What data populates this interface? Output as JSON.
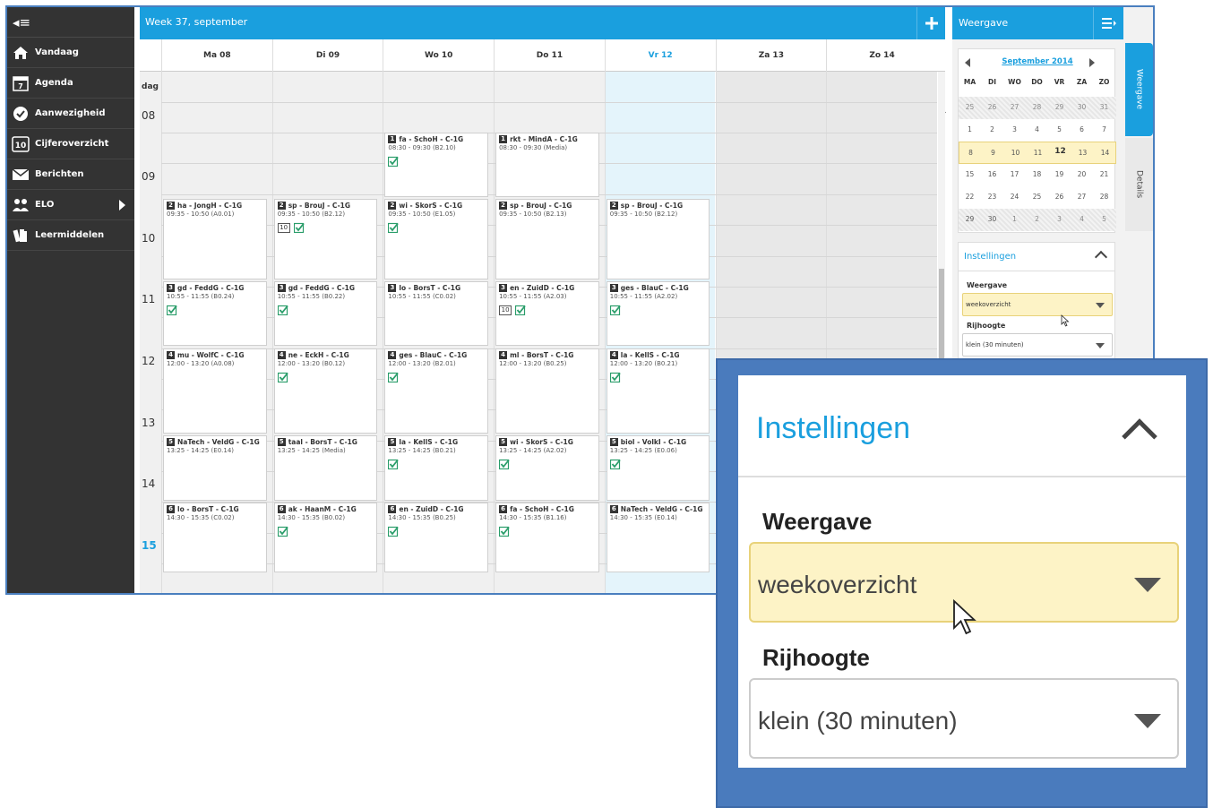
{
  "sidebar": {
    "collapse_icon": "collapse-menu-icon",
    "items": [
      {
        "label": "Vandaag",
        "icon": "home-icon"
      },
      {
        "label": "Agenda",
        "icon": "calendar-icon",
        "badge": "7"
      },
      {
        "label": "Aanwezigheid",
        "icon": "check-circle-icon"
      },
      {
        "label": "Cijferoverzicht",
        "icon": "grades-icon",
        "badge": "10"
      },
      {
        "label": "Berichten",
        "icon": "envelope-icon"
      },
      {
        "label": "ELO",
        "icon": "people-icon"
      },
      {
        "label": "Leermiddelen",
        "icon": "books-icon"
      }
    ]
  },
  "calendar": {
    "title": "Week 37, september",
    "add_icon": "plus-icon",
    "days": [
      "Ma 08",
      "Di 09",
      "Wo 10",
      "Do 11",
      "Vr 12",
      "Za 13",
      "Zo 14"
    ],
    "today_index": 4,
    "time_labels": [
      "dag",
      "08",
      "09",
      "10",
      "11",
      "12",
      "13",
      "14",
      "15"
    ],
    "events": [
      {
        "day": 2,
        "row": 0,
        "num": "1",
        "title": "fa - SchoH - C-1G",
        "time": "08:30 - 09:30 (B2.10)",
        "check": true,
        "ten": false
      },
      {
        "day": 3,
        "row": 0,
        "num": "1",
        "title": "rkt - MindA - C-1G",
        "time": "08:30 - 09:30 (Media)",
        "check": false,
        "ten": false
      },
      {
        "day": 0,
        "row": 1,
        "num": "2",
        "title": "ha - JongH - C-1G",
        "time": "09:35 - 10:50 (A0.01)",
        "check": false,
        "ten": false
      },
      {
        "day": 1,
        "row": 1,
        "num": "2",
        "title": "sp - BrouJ - C-1G",
        "time": "09:35 - 10:50 (B2.12)",
        "check": true,
        "ten": true
      },
      {
        "day": 2,
        "row": 1,
        "num": "2",
        "title": "wi - SkorS - C-1G",
        "time": "09:35 - 10:50 (E1.05)",
        "check": true,
        "ten": false
      },
      {
        "day": 3,
        "row": 1,
        "num": "2",
        "title": "sp - BrouJ - C-1G",
        "time": "09:35 - 10:50 (B2.13)",
        "check": false,
        "ten": false
      },
      {
        "day": 4,
        "row": 1,
        "num": "2",
        "title": "sp - BrouJ - C-1G",
        "time": "09:35 - 10:50 (B2.12)",
        "check": false,
        "ten": false
      },
      {
        "day": 0,
        "row": 2,
        "num": "3",
        "title": "gd - FeddG - C-1G",
        "time": "10:55 - 11:55 (B0.24)",
        "check": true,
        "ten": false
      },
      {
        "day": 1,
        "row": 2,
        "num": "3",
        "title": "gd - FeddG - C-1G",
        "time": "10:55 - 11:55 (B0.22)",
        "check": true,
        "ten": false
      },
      {
        "day": 2,
        "row": 2,
        "num": "3",
        "title": "lo - BorsT - C-1G",
        "time": "10:55 - 11:55 (C0.02)",
        "check": false,
        "ten": false
      },
      {
        "day": 3,
        "row": 2,
        "num": "3",
        "title": "en - ZuidD - C-1G",
        "time": "10:55 - 11:55 (A2.03)",
        "check": true,
        "ten": true
      },
      {
        "day": 4,
        "row": 2,
        "num": "3",
        "title": "ges - BlauC - C-1G",
        "time": "10:55 - 11:55 (A2.02)",
        "check": true,
        "ten": false
      },
      {
        "day": 0,
        "row": 3,
        "num": "4",
        "title": "mu - WolfC - C-1G",
        "time": "12:00 - 13:20 (A0.08)",
        "check": false,
        "ten": false
      },
      {
        "day": 1,
        "row": 3,
        "num": "4",
        "title": "ne - EckH - C-1G",
        "time": "12:00 - 13:20 (B0.12)",
        "check": true,
        "ten": false
      },
      {
        "day": 2,
        "row": 3,
        "num": "4",
        "title": "ges - BlauC - C-1G",
        "time": "12:00 - 13:20 (B2.01)",
        "check": true,
        "ten": false
      },
      {
        "day": 3,
        "row": 3,
        "num": "4",
        "title": "ml - BorsT - C-1G",
        "time": "12:00 - 13:20 (B0.25)",
        "check": false,
        "ten": false
      },
      {
        "day": 4,
        "row": 3,
        "num": "4",
        "title": "la - KellS - C-1G",
        "time": "12:00 - 13:20 (B0.21)",
        "check": true,
        "ten": false
      },
      {
        "day": 0,
        "row": 4,
        "num": "5",
        "title": "NaTech - VeldG - C-1G",
        "time": "13:25 - 14:25 (E0.14)",
        "check": false,
        "ten": false
      },
      {
        "day": 1,
        "row": 4,
        "num": "5",
        "title": "taal - BorsT - C-1G",
        "time": "13:25 - 14:25 (Media)",
        "check": false,
        "ten": false
      },
      {
        "day": 2,
        "row": 4,
        "num": "5",
        "title": "la - KellS - C-1G",
        "time": "13:25 - 14:25 (B0.21)",
        "check": true,
        "ten": false
      },
      {
        "day": 3,
        "row": 4,
        "num": "5",
        "title": "wi - SkorS - C-1G",
        "time": "13:25 - 14:25 (A2.02)",
        "check": true,
        "ten": false
      },
      {
        "day": 4,
        "row": 4,
        "num": "5",
        "title": "biol - VolkI - C-1G",
        "time": "13:25 - 14:25 (E0.06)",
        "check": true,
        "ten": false
      },
      {
        "day": 0,
        "row": 5,
        "num": "6",
        "title": "lo - BorsT - C-1G",
        "time": "14:30 - 15:35 (C0.02)",
        "check": false,
        "ten": false
      },
      {
        "day": 1,
        "row": 5,
        "num": "6",
        "title": "ak - HaanM - C-1G",
        "time": "14:30 - 15:35 (B0.02)",
        "check": true,
        "ten": false
      },
      {
        "day": 2,
        "row": 5,
        "num": "6",
        "title": "en - ZuidD - C-1G",
        "time": "14:30 - 15:35 (B0.25)",
        "check": true,
        "ten": false
      },
      {
        "day": 3,
        "row": 5,
        "num": "6",
        "title": "fa - SchoH - C-1G",
        "time": "14:30 - 15:35 (B1.16)",
        "check": true,
        "ten": false
      },
      {
        "day": 4,
        "row": 5,
        "num": "6",
        "title": "NaTech - VeldG - C-1G",
        "time": "14:30 - 15:35 (E0.14)",
        "check": false,
        "ten": false
      }
    ],
    "ten_label": "10"
  },
  "panel": {
    "title": "Weergave",
    "tabs": [
      "Weergave",
      "Details"
    ],
    "minical": {
      "title": "September 2014",
      "weekdays": [
        "MA",
        "DI",
        "WO",
        "DO",
        "VR",
        "ZA",
        "ZO"
      ],
      "weeks": [
        [
          "25",
          "26",
          "27",
          "28",
          "29",
          "30",
          "31"
        ],
        [
          "1",
          "2",
          "3",
          "4",
          "5",
          "6",
          "7"
        ],
        [
          "8",
          "9",
          "10",
          "11",
          "12",
          "13",
          "14"
        ],
        [
          "15",
          "16",
          "17",
          "18",
          "19",
          "20",
          "21"
        ],
        [
          "22",
          "23",
          "24",
          "25",
          "26",
          "27",
          "28"
        ],
        [
          "29",
          "30",
          "1",
          "2",
          "3",
          "4",
          "5"
        ]
      ],
      "current_week": 2,
      "today": "12"
    },
    "settings": {
      "title": "Instellingen",
      "weergave_label": "Weergave",
      "weergave_value": "weekoverzicht",
      "rijhoogte_label": "Rijhoogte",
      "rijhoogte_value": "klein (30 minuten)"
    }
  },
  "colors": {
    "accent": "#1a9fde",
    "sidebar": "#333333",
    "highlight": "#fdf3c6",
    "callout": "#4a7bbd"
  }
}
